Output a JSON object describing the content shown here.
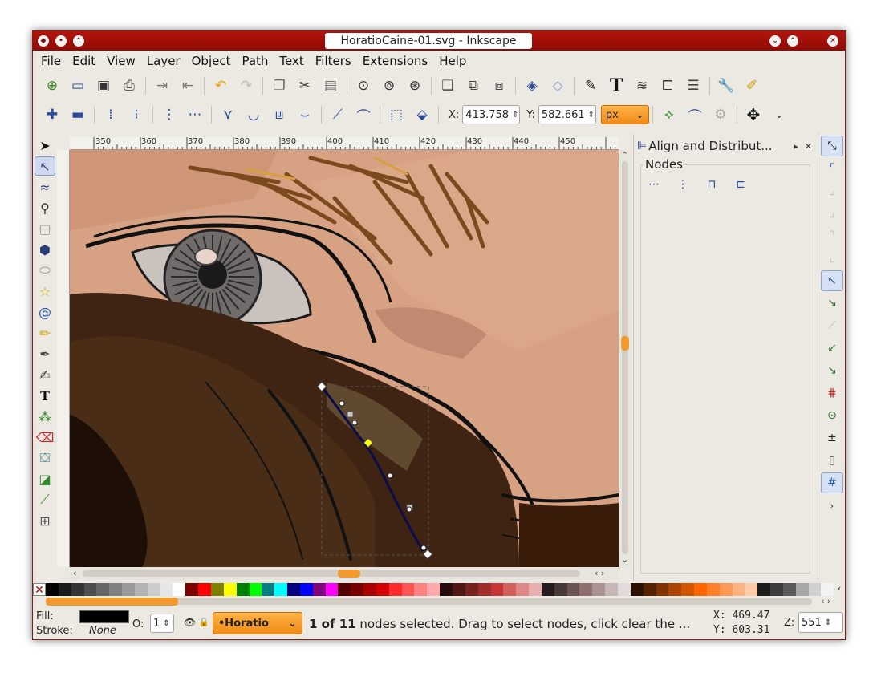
{
  "window": {
    "title": "HoratioCaine-01.svg - Inkscape"
  },
  "menu": [
    "File",
    "Edit",
    "View",
    "Layer",
    "Object",
    "Path",
    "Text",
    "Filters",
    "Extensions",
    "Help"
  ],
  "node_toolbar": {
    "x_label": "X:",
    "x_value": "413.758",
    "y_label": "Y:",
    "y_value": "582.661",
    "unit": "px"
  },
  "ruler": {
    "ticks": [
      "350",
      "360",
      "370",
      "380",
      "390",
      "400",
      "410",
      "420",
      "430",
      "440",
      "450"
    ]
  },
  "dock": {
    "panel_title": "Align and Distribut...",
    "section_label": "Nodes"
  },
  "status": {
    "fill_label": "Fill:",
    "stroke_label": "Stroke:",
    "stroke_value": "None",
    "opacity_label": "O:",
    "opacity_value": "1",
    "layer": "•Horatio",
    "message_bold": "1 of 11",
    "message_rest": " nodes selected. Drag to select nodes, click clear the ...",
    "cursor_x_label": "X:",
    "cursor_x": "469.47",
    "cursor_y_label": "Y:",
    "cursor_y": "603.31",
    "zoom_label": "Z:",
    "zoom_value": "551"
  },
  "colors": {
    "titlebar": "#a3110a",
    "accent_orange": "#f29a2e",
    "skin": "#d29a7a",
    "hair": "#3a1c0a"
  },
  "icons": {
    "cursor_arrow": "▸"
  },
  "palette": [
    "#000000",
    "#1a1a1a",
    "#333333",
    "#4d4d4d",
    "#666666",
    "#808080",
    "#999999",
    "#b3b3b3",
    "#cccccc",
    "#e6e6e6",
    "#ffffff",
    "#800000",
    "#ff0000",
    "#808000",
    "#ffff00",
    "#008000",
    "#00ff00",
    "#008080",
    "#00ffff",
    "#000080",
    "#0000ff",
    "#800080",
    "#ff00ff",
    "#550000",
    "#7a0000",
    "#aa0000",
    "#d40000",
    "#ff2a2a",
    "#ff5555",
    "#ff8080",
    "#ffaaaa",
    "#280b0b",
    "#501616",
    "#782121",
    "#a02c2c",
    "#c83737",
    "#d35f5f",
    "#de8787",
    "#e9afaf",
    "#241c1c",
    "#483737",
    "#6c5353",
    "#916f6f",
    "#ac9393",
    "#c8b7b7",
    "#e3dbdb",
    "#2b1100",
    "#552200",
    "#803300",
    "#aa4400",
    "#d45500",
    "#ff6600",
    "#ff7f2a",
    "#ff9955",
    "#ffb380",
    "#ffccaa",
    "#1c1c1c",
    "#3c3c3c",
    "#5a5a5a",
    "#a8a8a8",
    "#d0d0d0",
    "#f2f2f2"
  ]
}
